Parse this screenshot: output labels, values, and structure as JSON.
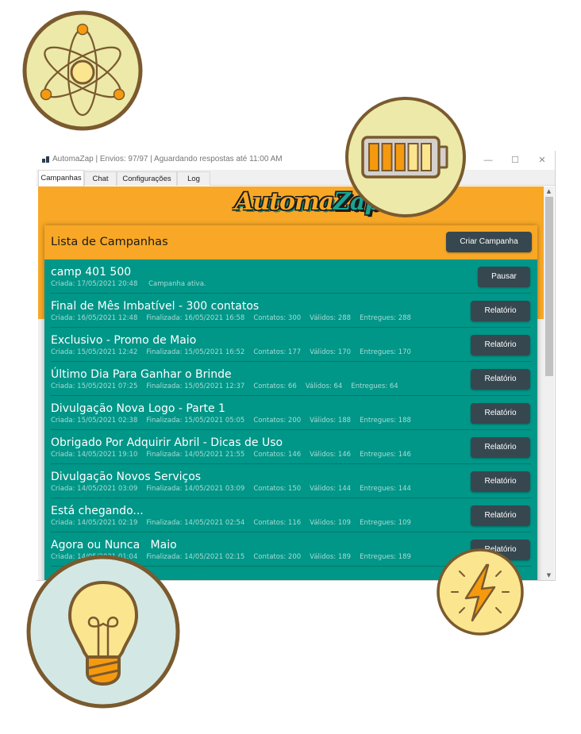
{
  "window": {
    "title": "AutomaZap | Envios: 97/97 | Aguardando respostas até 11:00 AM",
    "controls": {
      "minimize": "—",
      "maximize": "☐",
      "close": "✕"
    }
  },
  "tabs": [
    {
      "label": "Campanhas",
      "active": true
    },
    {
      "label": "Chat",
      "active": false
    },
    {
      "label": "Configurações",
      "active": false
    },
    {
      "label": "Log",
      "active": false
    }
  ],
  "logo": {
    "part1": "Automa",
    "part2": "Zap"
  },
  "panel": {
    "title": "Lista de Campanhas",
    "create_button": "Criar Campanha"
  },
  "campaigns": [
    {
      "name": "camp 401 500",
      "created": "Criada: 17/05/2021 20:48",
      "status": "Campanha ativa.",
      "button": "Pausar"
    },
    {
      "name": "Final de Mês Imbatível - 300 contatos",
      "created": "Criada: 16/05/2021 12:48",
      "finished": "Finalizada: 16/05/2021 16:58",
      "contacts": "Contatos: 300",
      "valid": "Válidos: 288",
      "delivered": "Entregues: 288",
      "button": "Relatório"
    },
    {
      "name": "Exclusivo - Promo de Maio",
      "created": "Criada: 15/05/2021 12:42",
      "finished": "Finalizada: 15/05/2021 16:52",
      "contacts": "Contatos: 177",
      "valid": "Válidos: 170",
      "delivered": "Entregues: 170",
      "button": "Relatório"
    },
    {
      "name": "Último Dia Para Ganhar o Brinde",
      "created": "Criada: 15/05/2021 07:25",
      "finished": "Finalizada: 15/05/2021 12:37",
      "contacts": "Contatos: 66",
      "valid": "Válidos: 64",
      "delivered": "Entregues: 64",
      "button": "Relatório"
    },
    {
      "name": "Divulgação Nova Logo - Parte 1",
      "created": "Criada: 15/05/2021 02:38",
      "finished": "Finalizada: 15/05/2021 05:05",
      "contacts": "Contatos: 200",
      "valid": "Válidos: 188",
      "delivered": "Entregues: 188",
      "button": "Relatório"
    },
    {
      "name": "Obrigado Por Adquirir Abril - Dicas de Uso",
      "created": "Criada: 14/05/2021 19:10",
      "finished": "Finalizada: 14/05/2021 21:55",
      "contacts": "Contatos: 146",
      "valid": "Válidos: 146",
      "delivered": "Entregues: 146",
      "button": "Relatório"
    },
    {
      "name": "Divulgação Novos Serviços",
      "created": "Criada: 14/05/2021 03:09",
      "finished": "Finalizada: 14/05/2021 03:09",
      "contacts": "Contatos: 150",
      "valid": "Válidos: 144",
      "delivered": "Entregues: 144",
      "button": "Relatório"
    },
    {
      "name": "Está chegando...",
      "created": "Criada: 14/05/2021 02:19",
      "finished": "Finalizada: 14/05/2021 02:54",
      "contacts": "Contatos: 116",
      "valid": "Válidos: 109",
      "delivered": "Entregues: 109",
      "button": "Relatório"
    },
    {
      "name": "Agora ou Nunca   Maio",
      "created": "Criada: 14/05/2021 01:04",
      "finished": "Finalizada: 14/05/2021 02:15",
      "contacts": "Contatos: 200",
      "valid": "Válidos: 189",
      "delivered": "Entregues: 189",
      "button": "Relatório"
    }
  ],
  "scrollbar": {
    "up": "▲",
    "down": "▼"
  },
  "decor": {
    "icons": [
      "atom-icon",
      "battery-icon",
      "lightbulb-icon",
      "lightning-icon"
    ],
    "battery_level": 0.6,
    "colors": {
      "outline": "#7a5a2e",
      "orange": "#f59a0f",
      "pale_yellow": "#ece9a9",
      "light_yellow": "#fbe58f",
      "pale_blue": "#d3e8e4"
    }
  }
}
